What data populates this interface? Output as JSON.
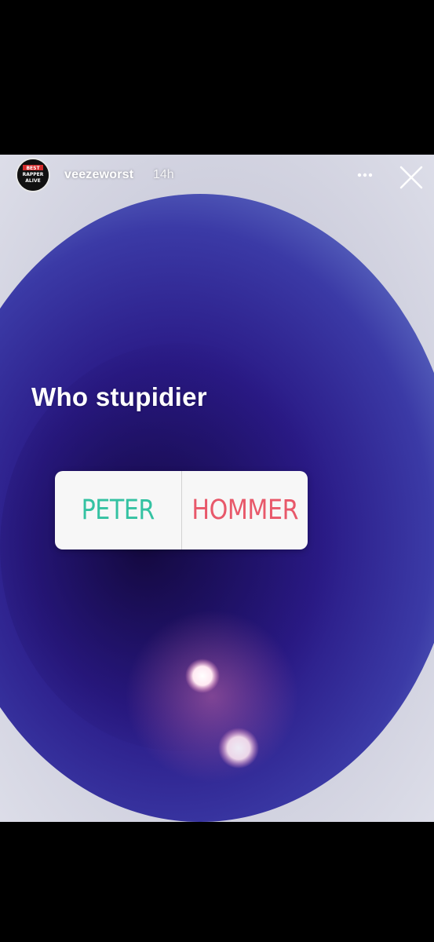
{
  "story": {
    "username": "veezeworst",
    "timestamp": "14h",
    "text": "Who stupidier",
    "avatar_logo_text": [
      "BEST",
      "RAPPER",
      "ALIVE"
    ]
  },
  "poll": {
    "options": [
      {
        "label": "PETER",
        "color": "#34c2a2"
      },
      {
        "label": "HOMMER",
        "color": "#e8586a"
      }
    ]
  },
  "icons": {
    "more": "more-horizontal-icon",
    "close": "close-icon"
  },
  "colors": {
    "frame_background": "#000000",
    "eye_blue": "#2e1f8a",
    "highlight_white": "#ffffff"
  }
}
